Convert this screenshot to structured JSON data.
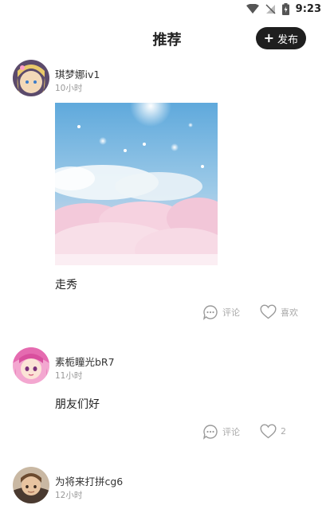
{
  "status_bar": {
    "time": "9:23"
  },
  "header": {
    "title": "推荐",
    "publish_label": "发布"
  },
  "posts": [
    {
      "username": "琪梦娜iv1",
      "time_ago": "10小时",
      "text": "走秀",
      "comment_label": "评论",
      "like_label": "喜欢"
    },
    {
      "username": "素栀瞳光bR7",
      "time_ago": "11小时",
      "text": "朋友们好",
      "comment_label": "评论",
      "like_label": "2"
    },
    {
      "username": "为将来打拼cg6",
      "time_ago": "12小时"
    }
  ]
}
